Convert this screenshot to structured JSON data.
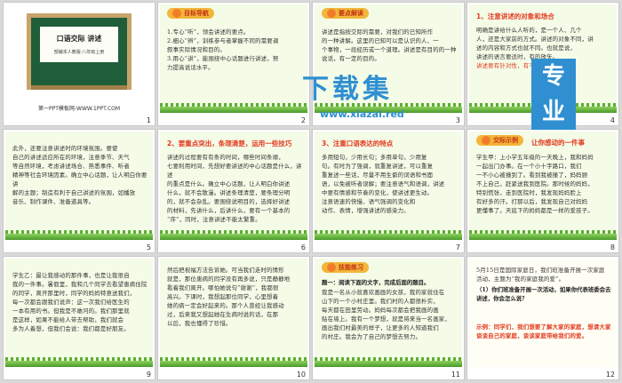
{
  "watermark": {
    "title": "下载集",
    "url": "www.xiazai.red",
    "badge": "专业"
  },
  "slides": [
    {
      "num": "1",
      "board_title": "口语交际  讲述",
      "board_sub": "部编本人教版·八年级上册",
      "link": "第一PPT模板网-WWW.1PPT.COM"
    },
    {
      "num": "2",
      "tag": "目标导航",
      "lines": [
        "1.专心“听”，领会讲述的要点。",
        "2.细心“辨”，训练参与者掌握不同的需要调",
        "  叙事实际情况和目的。",
        "3.用心“讲”，能围绕中心话题进行讲述，努",
        "  力提高说话水平。"
      ]
    },
    {
      "num": "3",
      "tag": "要点解读",
      "lines": [
        "讲述是指按交际的需要，对我们的已知所作",
        "的一种讲解。这里的已知可以是认识的人、一",
        "个事物，一段经历或一个道理。讲述是有目的的一种",
        "说话，有一定的目的。"
      ]
    },
    {
      "num": "4",
      "heading": "1、注意讲述的对象和场合",
      "lines": [
        "明确是讲给什么人听的，是一个人、几个",
        "人，还是大家前的方式。讲述的对象不同，讲",
        "述的内容和方式也就不同。也就是说，",
        "讲述的语言要适时，有的放矢。"
      ],
      "highlight": "讲述要有针对性，有不同言行"
    },
    {
      "num": "5",
      "lines": [
        "此外，还要注意讲述时的环境氛围。要使",
        "自己的讲述适应所在的环境，注意季节、天气",
        "等自然环境，考虑讲述场合、熟悉事件、听者",
        "精神等社会环境因素。确立中心话题，让人明白你要讲",
        "解的主题；制造有利于自己讲述的氛围，如播放",
        "音乐、制作课件、准备道具等。"
      ]
    },
    {
      "num": "6",
      "heading": "2、要重点突出，条理清楚，运用一些技巧",
      "lines": [
        "讲述的过程要有有条的时间，哪些时间条顺，",
        "七要利用时间，先想好要讲述的中心话题是什么，讲述",
        "的重点是什么。确立中心话题，让人明白你讲述",
        "什么，就不会散漫。讲述条理清楚，要条理分明",
        "的，就不会杂乱。要围绕说明目的，选择好讲述",
        "的材料，先讲什么，后讲什么，要有一个基本的",
        "“序”，同时，注意讲述不能太繁重。"
      ]
    },
    {
      "num": "7",
      "heading": "3、注重口语表达的特点",
      "lines": [
        "多用短句，少用长句；多用单句，少用复",
        "句。有时为了强调，就重复讲述，可以重复",
        "重复述一些话，尽量不用生僻的词语和书面",
        "语，以免被听者误解；要注意语气和语调，讲述",
        "中要有情感和节奏的变化，使讲述更生动。",
        "注意语速的快慢、语气强调的变化和",
        "动作、表情，增强讲述的感染力。"
      ]
    },
    {
      "num": "8",
      "tag": "交际示例",
      "heading": "让你感动的一件事",
      "lines": [
        "学生甲：上小学五年级的一天晚上，我和妈妈",
        "一起出门办事。在一个小十字路口，我们",
        "一不小心被撞到了。看到我被撞了，妈妈顾",
        "不上自己，赶紧送我到医院。那时候的妈妈，",
        "特别慌张，走到医院时，我发现妈妈脸上",
        "有好多的汗。打那以后，我发现自己对妈妈",
        "更懂事了。天底下的妈妈都是一样的爱孩子。"
      ]
    },
    {
      "num": "9",
      "lines": [
        "学生乙：最让我感动的那件事，也是让我很自",
        "我的一件事。暑假里，我和几个同学去看望患病住院",
        "的同学，离开那里时，同学的妈妈特意送我们，",
        "每一次都会跟我们说声：这一次我们给医生的",
        "一本有用的书。但我是不敢问的。我们那里就",
        "是这样，如果不能给人带去帮助，我们就会",
        "多为人着想，但我们会说：我们都是好朋友。"
      ]
    },
    {
      "num": "10",
      "lines": [
        "然后把祝福方法告诉她。可当我们走时的情形",
        "就是，那位患病的同学没有再多说，只是静静地",
        "看着我们离开。哪怕她说句“谢谢”，我都很",
        "高兴。下课时，我想起那位同学，心里想着",
        "她的病一定会好起来的。那个人曾经让我感动",
        "过，后来我又想起她在生病时说的话，在那",
        "以后，我也懂得了珍惜。"
      ]
    },
    {
      "num": "11",
      "tag": "技能练习",
      "heading": "题一：阅读下面的文字，完成后面的题目。",
      "lines": [
        "我是一名从小就喜欢画画的女孩，我的家就住在",
        "山下的一个小村庄里。我们村的人都很朴实，",
        "每天都在田里劳动。妈妈每次都会把我画的画",
        "贴在墙上。我有一个梦想，就是将来当一名画家，",
        "画出我们村最美的样子，让更多的人知道我们",
        "的村庄。我会为了自己的梦想去努力。"
      ]
    },
    {
      "num": "12",
      "lines": [
        "5月15日是国际家庭日，我们班准备开展一次家庭",
        "活动，主题为“我的家庭我的爱”。"
      ],
      "question": "（1）你们班准备开展一次活动，如果你代表班委会去讲述，你会怎么说？",
      "answer": "示例：同学们，我们想要了解大家的家庭，想请大家谈谈自己的家庭，谈谈家庭带给我们的爱。"
    }
  ]
}
